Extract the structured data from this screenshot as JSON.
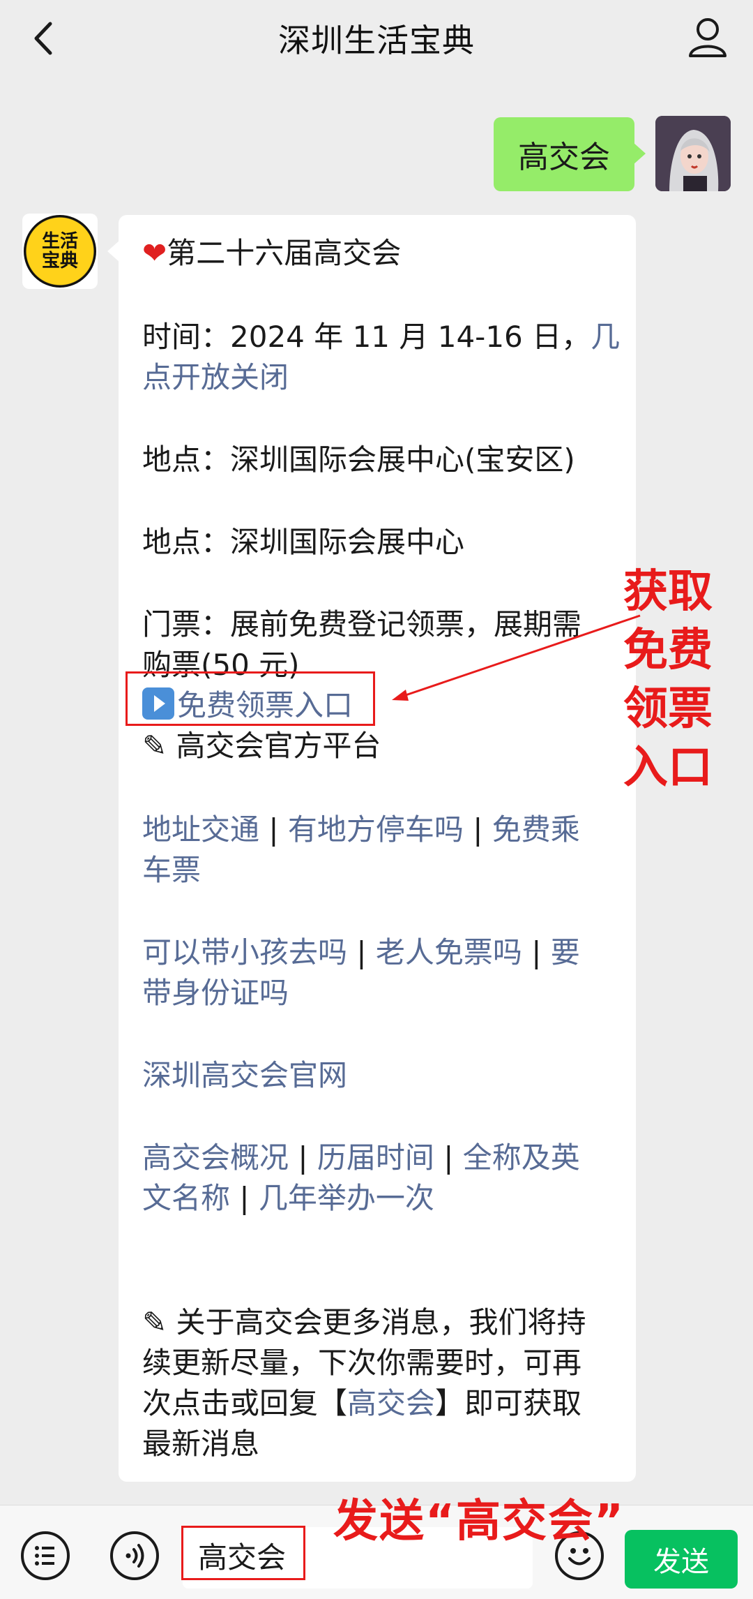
{
  "header": {
    "title": "深圳生活宝典",
    "back_icon": "chevron-left-icon",
    "profile_icon": "user-icon"
  },
  "messages": {
    "user_message": "高交会",
    "bot_avatar_text": [
      "生活",
      "宝典"
    ],
    "reply": {
      "title_emoji": "heart-emoji",
      "title": "第二十六届高交会",
      "time_label": "时间：2024 年 11 月 14-16 日，",
      "time_link_1": "几",
      "time_link_2": "点开放关闭",
      "venue_1": "地点：深圳国际会展中心(宝安区)",
      "venue_2": "地点：深圳国际会展中心",
      "ticket_1": "门票：展前免费登记领票，展期需",
      "ticket_2": "购票(50 元)",
      "free_ticket_link": "免费领票入口",
      "official_platform": "✎ 高交会官方平台",
      "link_address": "地址交通",
      "link_parking": "有地方停车吗",
      "link_free_ride_1": "免费乘",
      "link_free_ride_2": "车票",
      "link_kids": "可以带小孩去吗",
      "link_elderly": "老人免票吗",
      "link_id_1": "要",
      "link_id_2": "带身份证吗",
      "link_official_site": "深圳高交会官网",
      "link_overview": "高交会概况",
      "link_history": "历届时间",
      "link_fullname_1": "全称及英",
      "link_fullname_2": "文名称",
      "link_frequency": "几年举办一次",
      "separator": "|",
      "footer_1": "✎ 关于高交会更多消息，我们将持",
      "footer_2": "续更新尽量，下次你需要时，可再",
      "footer_3a": "次点击或回复【",
      "footer_3_link": "高交会",
      "footer_3b": "】即可获取",
      "footer_4": "最新消息"
    }
  },
  "annotations": {
    "side_lines": [
      "获取",
      "免费",
      "领票",
      "入口"
    ],
    "bottom": "发送“高交会”"
  },
  "input_bar": {
    "menu_icon": "list-icon",
    "voice_icon": "voice-icon",
    "input_value": "高交会",
    "emoji_icon": "smiley-icon",
    "send_label": "发送"
  },
  "colors": {
    "accent_green": "#07c160",
    "bubble_green": "#95ec69",
    "link_blue": "#576b95",
    "annotation_red": "#e81b1b"
  }
}
